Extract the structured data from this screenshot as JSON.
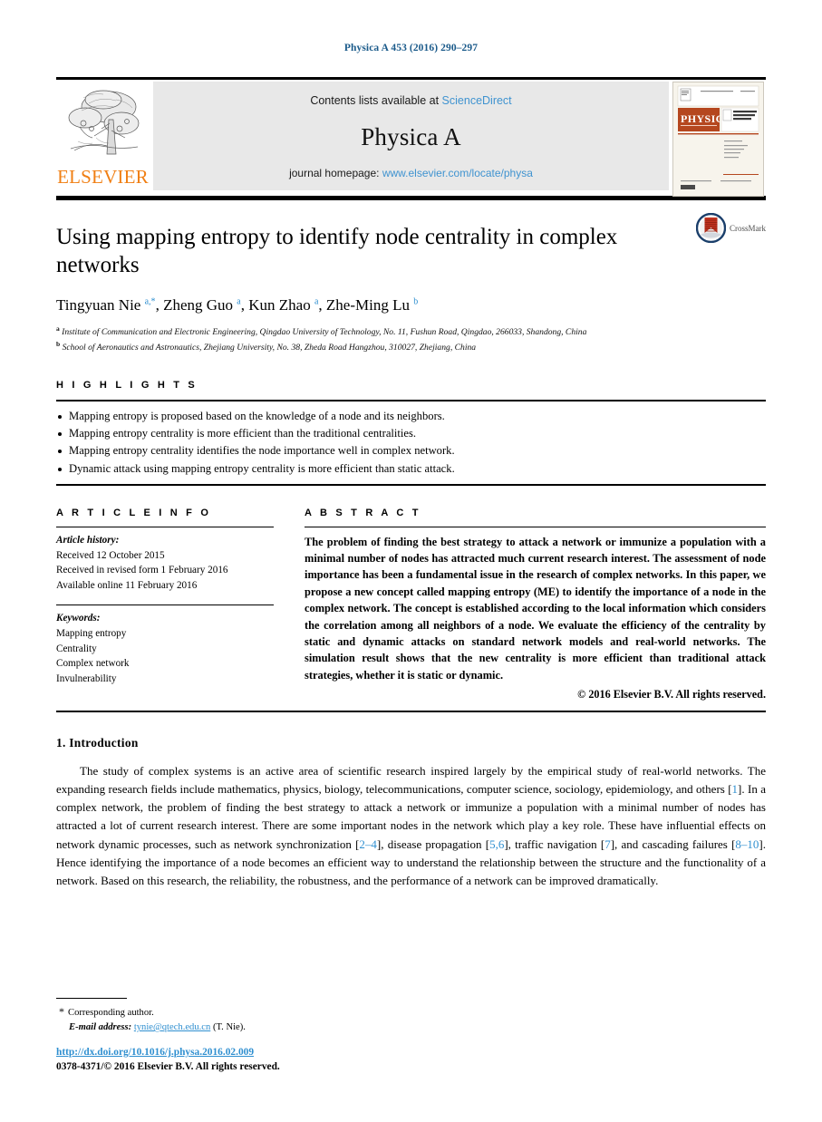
{
  "running_head": "Physica A 453 (2016) 290–297",
  "masthead": {
    "publisher_logo_text": "ELSEVIER",
    "contents_prefix": "Contents lists available at",
    "contents_link": "ScienceDirect",
    "journal_name": "Physica A",
    "homepage_prefix": "journal homepage:",
    "homepage_url": "www.elsevier.com/locate/physa",
    "cover_title": "PHYSICA",
    "cover_subtitle": "STATISTICAL MECHANICS AND ITS APPLICATIONS"
  },
  "article": {
    "title": "Using mapping entropy to identify node centrality in complex networks",
    "crossmark_label": "CrossMark",
    "authors_html": "Tingyuan Nie <sup>a,*</sup>, Zheng Guo <sup>a</sup>, Kun Zhao <sup>a</sup>, Zhe-Ming Lu <sup>b</sup>",
    "affiliations": [
      {
        "marker": "a",
        "text": "Institute of Communication and Electronic Engineering, Qingdao University of Technology, No. 11, Fushun Road, Qingdao, 266033, Shandong, China"
      },
      {
        "marker": "b",
        "text": "School of Aeronautics and Astronautics, Zhejiang University, No. 38, Zheda Road Hangzhou, 310027, Zhejiang, China"
      }
    ]
  },
  "highlights": {
    "heading": "H I G H L I G H T S",
    "items": [
      "Mapping entropy is proposed based on the knowledge of a node and its neighbors.",
      "Mapping entropy centrality is more efficient than the traditional centralities.",
      "Mapping entropy centrality identifies the node importance well in complex network.",
      "Dynamic attack using mapping entropy centrality is more efficient than static attack."
    ]
  },
  "article_info": {
    "heading": "A R T I C L E    I N F O",
    "history_label": "Article history:",
    "history": [
      "Received 12 October 2015",
      "Received in revised form 1 February 2016",
      "Available online 11 February 2016"
    ],
    "keywords_label": "Keywords:",
    "keywords": [
      "Mapping entropy",
      "Centrality",
      "Complex network",
      "Invulnerability"
    ]
  },
  "abstract": {
    "heading": "A B S T R A C T",
    "body": "The problem of finding the best strategy to attack a network or immunize a population with a minimal number of nodes has attracted much current research interest. The assessment of node importance has been a fundamental issue in the research of complex networks. In this paper, we propose a new concept called mapping entropy (ME) to identify the importance of a node in the complex network. The concept is established according to the local information which considers the correlation among all neighbors of a node. We evaluate the efficiency of the centrality by static and dynamic attacks on standard network models and real-world networks. The simulation result shows that the new centrality is more efficient than traditional attack strategies, whether it is static or dynamic.",
    "copyright": "© 2016 Elsevier B.V. All rights reserved."
  },
  "introduction": {
    "heading": "1. Introduction",
    "paragraph_html": "The study of complex systems is an active area of scientific research inspired largely by the empirical study of real-world networks. The expanding research fields include mathematics, physics, biology, telecommunications, computer science, sociology, epidemiology, and others [<span class=\"ref\">1</span>]. In a complex network, the problem of finding the best strategy to attack a network or immunize a population with a minimal number of nodes has attracted a lot of current research interest. There are some important nodes in the network which play a key role. These have influential effects on network dynamic processes, such as network synchronization [<span class=\"ref\">2–4</span>], disease propagation [<span class=\"ref\">5,6</span>], traffic navigation [<span class=\"ref\">7</span>], and cascading failures [<span class=\"ref\">8–10</span>]. Hence identifying the importance of a node becomes an efficient way to understand the relationship between the structure and the functionality of a network. Based on this research, the reliability, the robustness, and the performance of a network can be improved dramatically."
  },
  "footer": {
    "corresponding_author": "Corresponding author.",
    "email_label": "E-mail address:",
    "email": "tynie@qtech.edu.cn",
    "email_suffix": "(T. Nie).",
    "doi_url": "http://dx.doi.org/10.1016/j.physa.2016.02.009",
    "issn_line": "0378-4371/© 2016 Elsevier B.V. All rights reserved."
  },
  "colors": {
    "link_blue": "#2f8fd0",
    "sd_blue": "#3f93d0",
    "running_head_blue": "#1a5a8a",
    "elsevier_orange": "#f07f13",
    "band_gray": "#e8e8e8"
  }
}
